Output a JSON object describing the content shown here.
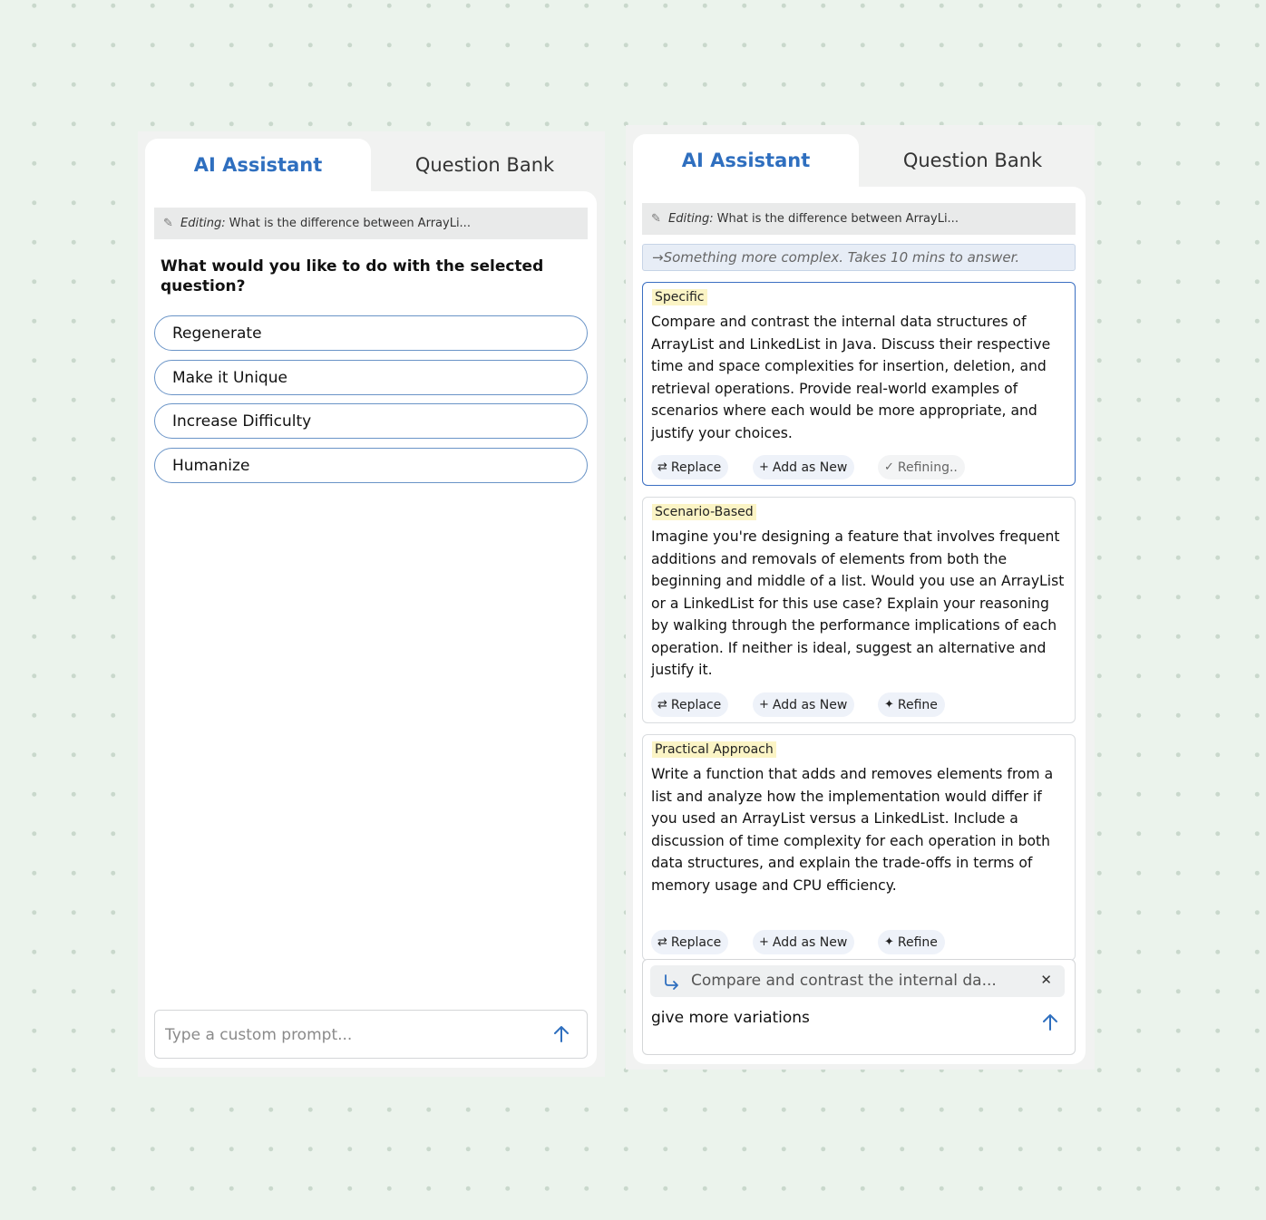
{
  "left": {
    "tabs": {
      "active": "AI Assistant",
      "inactive": "Question Bank"
    },
    "editing": {
      "label": "Editing:",
      "text": "What is the difference between ArrayLi..."
    },
    "question": "What would you like to do with the selected question?",
    "options": [
      "Regenerate",
      "Make it Unique",
      "Increase Difficulty",
      "Humanize"
    ],
    "prompt_placeholder": "Type a custom prompt..."
  },
  "right": {
    "tabs": {
      "active": "AI Assistant",
      "inactive": "Question Bank"
    },
    "editing": {
      "label": "Editing:",
      "text": "What is the difference between ArrayLi..."
    },
    "hint": "→Something more complex. Takes 10 mins to answer.",
    "cards": [
      {
        "tag": "Specific",
        "text": "Compare and contrast the internal data structures of ArrayList and LinkedList in Java. Discuss their respective time and space complexities for insertion, deletion, and retrieval operations. Provide real-world examples of scenarios where each would be more appropriate, and justify your choices.",
        "actions": [
          "Replace",
          "Add as New",
          "Refining.."
        ]
      },
      {
        "tag": "Scenario-Based",
        "text": "Imagine you're designing a feature that involves frequent additions and removals of elements from both the beginning and middle of a list. Would you use an ArrayList or a LinkedList for this use case? Explain your reasoning by walking through the performance implications of each operation. If neither is ideal, suggest an alternative and justify it.",
        "actions": [
          "Replace",
          "Add as New",
          "Refine"
        ]
      },
      {
        "tag": "Practical Approach",
        "text": "Write a function that adds and removes elements from a list and analyze how the implementation would differ if you used an ArrayList versus a LinkedList. Include a discussion of time complexity for each operation in both data structures, and explain the trade-offs in terms of memory usage and CPU efficiency.",
        "actions": [
          "Replace",
          "Add as New",
          "Refine"
        ]
      }
    ],
    "compose": {
      "quote": "Compare and contrast the internal da...",
      "typed": "give more variations"
    }
  },
  "colors": {
    "accent": "#2f6fbf",
    "tag_bg": "#fbf4c5",
    "selected_border": "#3b6fc2"
  }
}
